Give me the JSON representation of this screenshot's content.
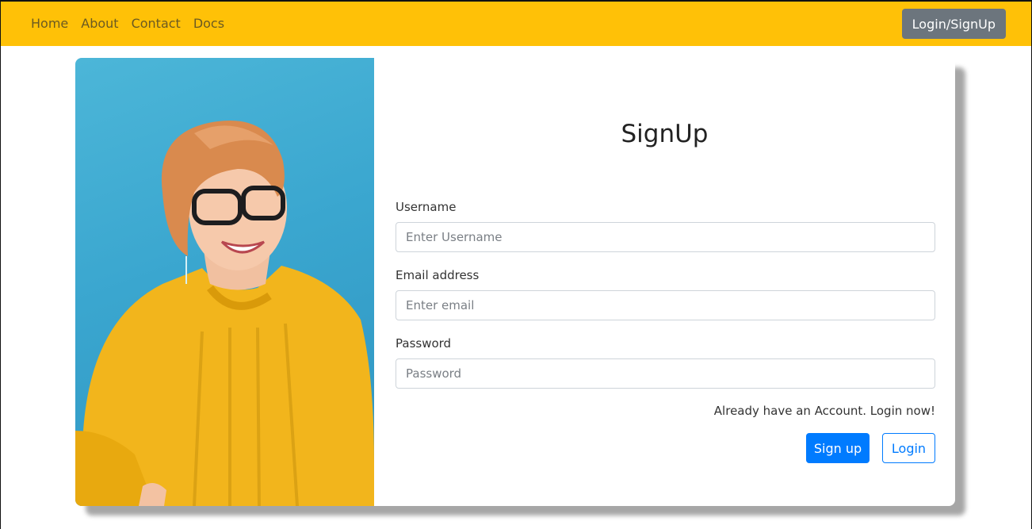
{
  "navbar": {
    "links": [
      "Home",
      "About",
      "Contact",
      "Docs"
    ],
    "auth_button": "Login/SignUp",
    "background": "#ffc107"
  },
  "form": {
    "title": "SignUp",
    "username": {
      "label": "Username",
      "placeholder": "Enter Username",
      "value": ""
    },
    "email": {
      "label": "Email address",
      "placeholder": "Enter email",
      "value": ""
    },
    "password": {
      "label": "Password",
      "placeholder": "Password",
      "value": ""
    },
    "login_prompt": "Already have an Account. Login now!",
    "signup_button": "Sign up",
    "login_button": "Login"
  },
  "colors": {
    "primary": "#007bff",
    "secondary": "#6c757d",
    "accent": "#ffc107"
  }
}
